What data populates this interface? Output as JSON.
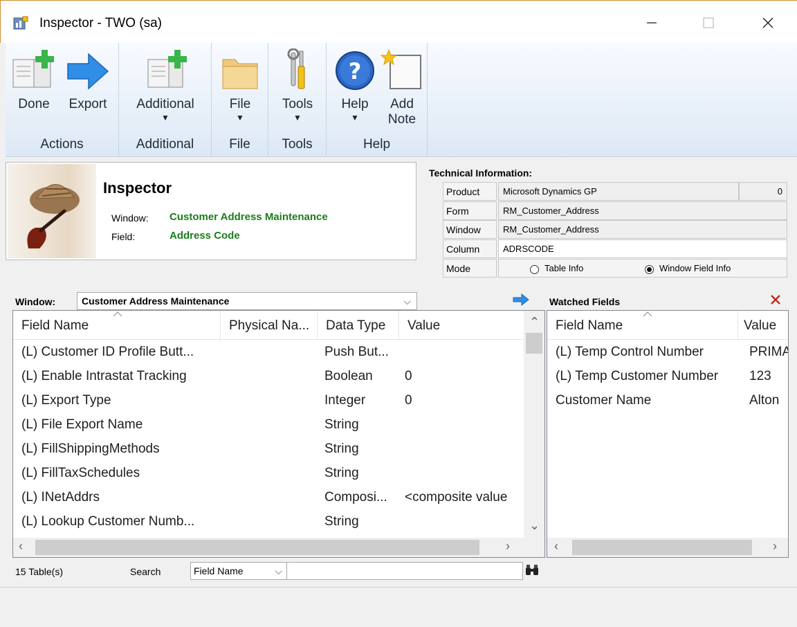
{
  "window": {
    "title": "Inspector  -  TWO (sa)",
    "minimize_icon": "minimize-icon",
    "maximize_icon": "maximize-icon",
    "close_icon": "close-icon"
  },
  "ribbon": {
    "groups": [
      {
        "label": "Actions",
        "buttons": [
          {
            "label": "Done",
            "icon": "done-icon"
          },
          {
            "label": "Export",
            "icon": "export-arrow-icon"
          }
        ]
      },
      {
        "label": "Additional",
        "buttons": [
          {
            "label": "Additional",
            "icon": "additional-icon"
          }
        ]
      },
      {
        "label": "File",
        "buttons": [
          {
            "label": "File",
            "icon": "folder-icon"
          }
        ]
      },
      {
        "label": "Tools",
        "buttons": [
          {
            "label": "Tools",
            "icon": "tools-icon"
          }
        ]
      },
      {
        "label": "Help",
        "buttons": [
          {
            "label": "Help",
            "icon": "help-icon"
          },
          {
            "label": "Add",
            "label2": "Note",
            "icon": "add-note-icon"
          }
        ]
      }
    ]
  },
  "inspector": {
    "title": "Inspector",
    "window_label": "Window:",
    "window_value": "Customer Address Maintenance",
    "field_label": "Field:",
    "field_value": "Address Code"
  },
  "technical": {
    "title": "Technical Information:",
    "product_label": "Product",
    "product_value": "Microsoft Dynamics GP",
    "product_id": "0",
    "form_label": "Form",
    "form_value": "RM_Customer_Address",
    "window_label": "Window",
    "window_value": "RM_Customer_Address",
    "column_label": "Column",
    "column_value": "ADRSCODE",
    "mode_label": "Mode",
    "mode_option1": "Table Info",
    "mode_option2": "Window Field Info",
    "mode_selected": "Window Field Info"
  },
  "window_select": {
    "label": "Window:",
    "value": "Customer Address Maintenance"
  },
  "grid": {
    "columns": [
      "Field Name",
      "Physical Na...",
      "Data Type",
      "Value"
    ],
    "rows": [
      {
        "name": "(L) Customer ID Profile Butt...",
        "physical": "",
        "type": "Push But...",
        "value": ""
      },
      {
        "name": "(L) Enable Intrastat Tracking",
        "physical": "",
        "type": "Boolean",
        "value": "0"
      },
      {
        "name": "(L) Export Type",
        "physical": "",
        "type": "Integer",
        "value": "0"
      },
      {
        "name": "(L) File Export Name",
        "physical": "",
        "type": "String",
        "value": ""
      },
      {
        "name": "(L) FillShippingMethods",
        "physical": "",
        "type": "String",
        "value": ""
      },
      {
        "name": "(L) FillTaxSchedules",
        "physical": "",
        "type": "String",
        "value": ""
      },
      {
        "name": "(L) INetAddrs",
        "physical": "",
        "type": "Composi...",
        "value": "<composite value"
      },
      {
        "name": "(L) Lookup Customer Numb...",
        "physical": "",
        "type": "String",
        "value": ""
      }
    ]
  },
  "watched": {
    "title": "Watched Fields",
    "columns": [
      "Field Name",
      "Value"
    ],
    "rows": [
      {
        "name": "(L) Temp Control Number",
        "value": "PRIMA"
      },
      {
        "name": "(L) Temp Customer Number",
        "value": "123"
      },
      {
        "name": "Customer Name",
        "value": "Alton"
      }
    ]
  },
  "footer": {
    "tables_count": "15 Table(s)",
    "search_label": "Search",
    "search_by": "Field Name",
    "search_value": ""
  },
  "colors": {
    "accent_green": "#1b7d1b",
    "remove_red": "#c0281b",
    "arrow_blue": "#2f8ee5"
  }
}
